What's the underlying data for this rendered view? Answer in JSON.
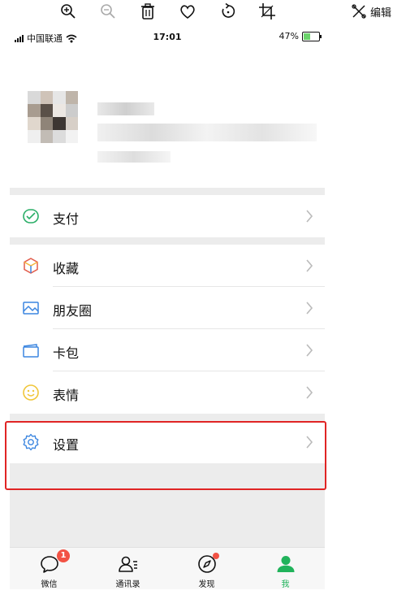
{
  "toolbar": {
    "icons": [
      "zoom-in-icon",
      "zoom-out-icon",
      "trash-icon",
      "heart-icon",
      "rotate-icon",
      "crop-icon"
    ],
    "edit_label": "编辑"
  },
  "status": {
    "carrier": "中国联通",
    "time": "17:01",
    "battery": "47%",
    "battery_level": 0.47
  },
  "menu": [
    {
      "label": "支付",
      "icon": "pay-icon",
      "color": "#2aae67"
    },
    {
      "label": "收藏",
      "icon": "favorites-icon",
      "color": "#f4b63f"
    },
    {
      "label": "朋友圈",
      "icon": "moments-icon",
      "color": "#3c86e0"
    },
    {
      "label": "卡包",
      "icon": "card-icon",
      "color": "#3c86e0"
    },
    {
      "label": "表情",
      "icon": "sticker-icon",
      "color": "#f0c63a"
    },
    {
      "label": "设置",
      "icon": "gear-icon",
      "color": "#3c86e0"
    }
  ],
  "tabs": [
    {
      "label": "微信",
      "icon": "chat-icon",
      "badge": "1"
    },
    {
      "label": "通讯录",
      "icon": "contacts-icon"
    },
    {
      "label": "发现",
      "icon": "compass-icon"
    },
    {
      "label": "我",
      "icon": "me-icon",
      "active": true
    }
  ],
  "colors": {
    "accent": "#21b35b",
    "badge": "#f25244",
    "highlight": "#e02424"
  }
}
